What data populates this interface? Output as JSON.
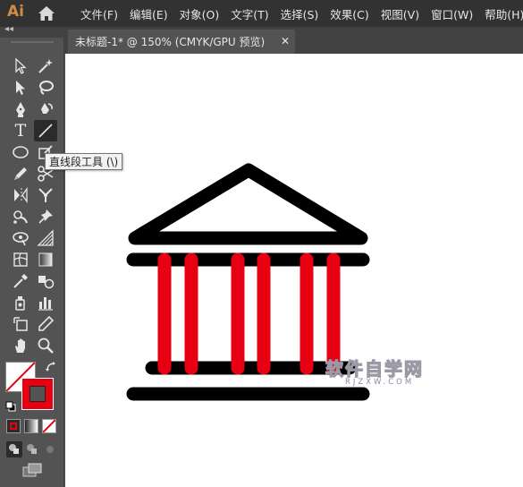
{
  "app": {
    "logo_text": "Ai",
    "logo_color": "#d28b47"
  },
  "menu": {
    "items": [
      "文件(F)",
      "编辑(E)",
      "对象(O)",
      "文字(T)",
      "选择(S)",
      "效果(C)",
      "视图(V)",
      "窗口(W)",
      "帮助(H)"
    ]
  },
  "document_tab": {
    "title": "未标题-1* @ 150% (CMYK/GPU 预览)",
    "close_glyph": "✕"
  },
  "toolbar": {
    "collapse_glyph": "◂◂",
    "type_tool_glyph": "T",
    "active_tool": "line-segment-tool",
    "fill_color": "#ffffff",
    "stroke_color": "#e60012"
  },
  "tooltip": {
    "text": "直线段工具 (\\)"
  },
  "artwork": {
    "stroke_black": "#000000",
    "column_red": "#e60012"
  },
  "watermark": {
    "text": "软件自学网",
    "url_text": "RJZXW.COM"
  }
}
